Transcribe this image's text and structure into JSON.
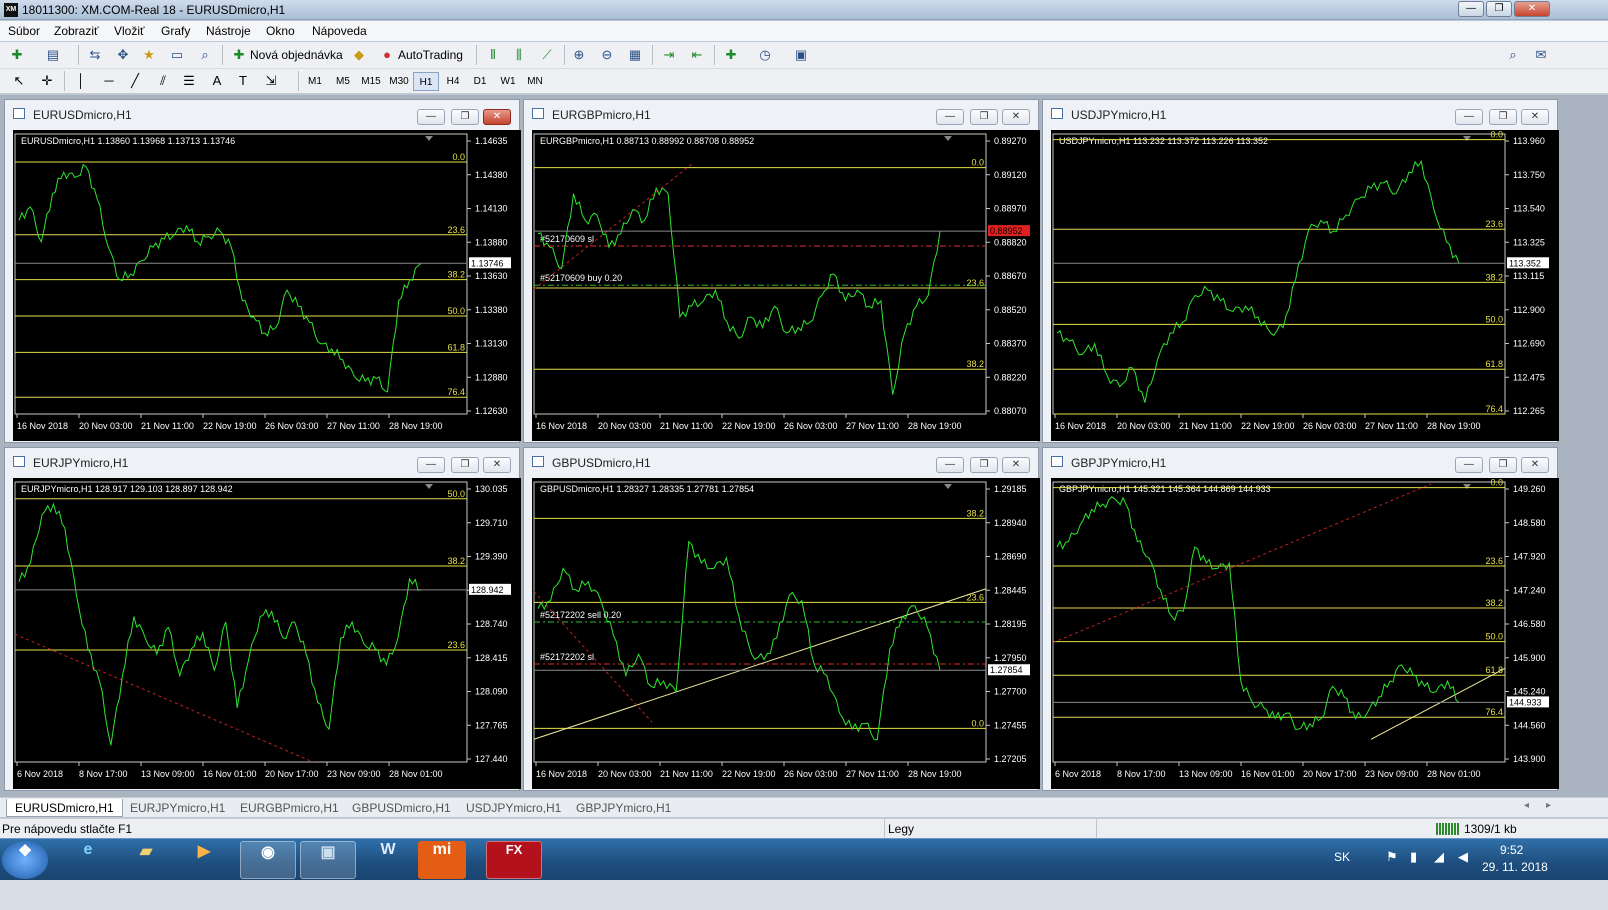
{
  "window": {
    "title": "18011300: XM.COM-Real 18 - EURUSDmicro,H1",
    "icon": "XM",
    "minimize": "—",
    "maximize": "❐",
    "close": "✕"
  },
  "menu": [
    "Súbor",
    "Zobraziť",
    "Vložiť",
    "Grafy",
    "Nástroje",
    "Okno",
    "Nápoveda"
  ],
  "toolbar": {
    "new_order": "Nová objednávka",
    "autotrading": "AutoTrading"
  },
  "timeframes": [
    "M1",
    "M5",
    "M15",
    "M30",
    "H1",
    "H4",
    "D1",
    "W1",
    "MN"
  ],
  "active_timeframe": "H1",
  "charts": [
    {
      "title": "EURUSDmicro,H1",
      "info": "EURUSDmicro,H1  1.13860 1.13968 1.13713 1.13746",
      "prices": [
        "1.14635",
        "1.14380",
        "1.14130",
        "1.13880",
        "1.13630",
        "1.13380",
        "1.13130",
        "1.12880",
        "1.12630"
      ],
      "current": "1.13746",
      "current_color": "#ffffff",
      "fib": [
        {
          "label": "0.0",
          "y": 0.1
        },
        {
          "label": "23.6",
          "y": 0.36
        },
        {
          "label": "38.2",
          "y": 0.52
        },
        {
          "label": "50.0",
          "y": 0.65
        },
        {
          "label": "61.8",
          "y": 0.78
        },
        {
          "label": "76.4",
          "y": 0.94
        }
      ],
      "dates": [
        "16 Nov 2018",
        "20 Nov 03:00",
        "21 Nov 11:00",
        "22 Nov 19:00",
        "26 Nov 03:00",
        "27 Nov 11:00",
        "28 Nov 19:00"
      ],
      "series": [
        0.3,
        0.25,
        0.38,
        0.2,
        0.12,
        0.14,
        0.1,
        0.22,
        0.4,
        0.52,
        0.5,
        0.45,
        0.4,
        0.37,
        0.35,
        0.32,
        0.38,
        0.36,
        0.34,
        0.4,
        0.6,
        0.66,
        0.72,
        0.7,
        0.56,
        0.62,
        0.68,
        0.76,
        0.78,
        0.82,
        0.88,
        0.9,
        0.89,
        0.94,
        0.6,
        0.52,
        0.46
      ],
      "active": true
    },
    {
      "title": "EURGBPmicro,H1",
      "info": "EURGBPmicro,H1  0.88713 0.88992 0.88708 0.88952",
      "prices": [
        "0.89270",
        "0.89120",
        "0.88970",
        "0.88820",
        "0.88670",
        "0.88520",
        "0.88370",
        "0.88220",
        "0.88070"
      ],
      "current": "0.88952",
      "current_color": "#ff3030",
      "fib": [
        {
          "label": "0.0",
          "y": 0.12
        },
        {
          "label": "23.6",
          "y": 0.55
        },
        {
          "label": "38.2",
          "y": 0.84
        }
      ],
      "orders": [
        {
          "label": "#52170609 sl",
          "y": 0.4
        },
        {
          "label": "#52170609 buy 0.20",
          "y": 0.54
        }
      ],
      "dates": [
        "16 Nov 2018",
        "20 Nov 03:00",
        "21 Nov 11:00",
        "22 Nov 19:00",
        "26 Nov 03:00",
        "27 Nov 11:00",
        "28 Nov 19:00"
      ],
      "series": [
        0.35,
        0.4,
        0.48,
        0.2,
        0.3,
        0.28,
        0.4,
        0.35,
        0.26,
        0.3,
        0.18,
        0.2,
        0.66,
        0.62,
        0.6,
        0.56,
        0.68,
        0.74,
        0.66,
        0.7,
        0.62,
        0.72,
        0.7,
        0.68,
        0.58,
        0.5,
        0.6,
        0.56,
        0.62,
        0.6,
        0.95,
        0.72,
        0.62,
        0.58,
        0.34
      ],
      "active": false
    },
    {
      "title": "USDJPYmicro,H1",
      "info": "USDJPYmicro,H1  113.232 113.372 113.226 113.352",
      "prices": [
        "113.960",
        "113.750",
        "113.540",
        "113.325",
        "113.115",
        "112.900",
        "112.690",
        "112.475",
        "112.265"
      ],
      "current": "113.352",
      "current_color": "#ffffff",
      "fib": [
        {
          "label": "0.0",
          "y": 0.02
        },
        {
          "label": "23.6",
          "y": 0.34
        },
        {
          "label": "38.2",
          "y": 0.53
        },
        {
          "label": "50.0",
          "y": 0.68
        },
        {
          "label": "61.8",
          "y": 0.84
        },
        {
          "label": "76.4",
          "y": 1.0
        }
      ],
      "dates": [
        "16 Nov 2018",
        "20 Nov 03:00",
        "21 Nov 11:00",
        "22 Nov 19:00",
        "26 Nov 03:00",
        "27 Nov 11:00",
        "28 Nov 19:00"
      ],
      "series": [
        0.72,
        0.75,
        0.8,
        0.76,
        0.88,
        0.92,
        0.85,
        0.98,
        0.82,
        0.72,
        0.68,
        0.58,
        0.56,
        0.6,
        0.64,
        0.62,
        0.66,
        0.72,
        0.7,
        0.52,
        0.34,
        0.3,
        0.34,
        0.28,
        0.22,
        0.18,
        0.16,
        0.2,
        0.12,
        0.08,
        0.26,
        0.38,
        0.46
      ],
      "active": false
    },
    {
      "title": "EURJPYmicro,H1",
      "info": "EURJPYmicro,H1  128.917 129.103 128.897 128.942",
      "prices": [
        "130.035",
        "129.710",
        "129.390",
        "129.065",
        "128.740",
        "128.415",
        "128.090",
        "127.765",
        "127.440"
      ],
      "current": "128.942",
      "current_color": "#ffffff",
      "fib": [
        {
          "label": "50.0",
          "y": 0.06
        },
        {
          "label": "38.2",
          "y": 0.3
        },
        {
          "label": "23.6",
          "y": 0.6
        }
      ],
      "dates": [
        "6 Nov 2018",
        "8 Nov 17:00",
        "13 Nov 09:00",
        "16 Nov 01:00",
        "20 Nov 17:00",
        "23 Nov 09:00",
        "28 Nov 01:00"
      ],
      "series": [
        0.35,
        0.28,
        0.1,
        0.06,
        0.15,
        0.4,
        0.6,
        0.72,
        0.96,
        0.7,
        0.48,
        0.56,
        0.62,
        0.52,
        0.7,
        0.6,
        0.54,
        0.68,
        0.5,
        0.82,
        0.64,
        0.48,
        0.46,
        0.56,
        0.5,
        0.62,
        0.8,
        0.9,
        0.56,
        0.5,
        0.58,
        0.6,
        0.66,
        0.56,
        0.34,
        0.38
      ],
      "active": false
    },
    {
      "title": "GBPUSDmicro,H1",
      "info": "GBPUSDmicro,H1  1.28327 1.28335 1.27781 1.27854",
      "prices": [
        "1.29185",
        "1.28940",
        "1.28690",
        "1.28445",
        "1.28195",
        "1.27950",
        "1.27700",
        "1.27455",
        "1.27205"
      ],
      "current": "1.27854",
      "current_color": "#ffffff",
      "fib": [
        {
          "label": "38.2",
          "y": 0.13
        },
        {
          "label": "23.6",
          "y": 0.43
        },
        {
          "label": "0.0",
          "y": 0.88
        }
      ],
      "orders": [
        {
          "label": "#52172202 sell 0.20",
          "y": 0.5
        },
        {
          "label": "#52172202 sl",
          "y": 0.65
        }
      ],
      "dates": [
        "16 Nov 2018",
        "20 Nov 03:00",
        "21 Nov 11:00",
        "22 Nov 19:00",
        "26 Nov 03:00",
        "27 Nov 11:00",
        "28 Nov 19:00"
      ],
      "series": [
        0.45,
        0.42,
        0.3,
        0.38,
        0.35,
        0.42,
        0.55,
        0.7,
        0.62,
        0.74,
        0.72,
        0.76,
        0.2,
        0.28,
        0.3,
        0.26,
        0.48,
        0.62,
        0.64,
        0.56,
        0.4,
        0.42,
        0.66,
        0.7,
        0.84,
        0.9,
        0.88,
        0.94,
        0.6,
        0.48,
        0.44,
        0.52,
        0.68
      ],
      "active": false
    },
    {
      "title": "GBPJPYmicro,H1",
      "info": "GBPJPYmicro,H1  145.321 145.364 144.869 144.933",
      "prices": [
        "149.260",
        "148.580",
        "147.920",
        "147.240",
        "146.580",
        "145.900",
        "145.240",
        "144.560",
        "143.900"
      ],
      "current": "144.933",
      "current_color": "#ffffff",
      "fib": [
        {
          "label": "0.0",
          "y": 0.02
        },
        {
          "label": "23.6",
          "y": 0.3
        },
        {
          "label": "38.2",
          "y": 0.45
        },
        {
          "label": "50.0",
          "y": 0.57
        },
        {
          "label": "61.8",
          "y": 0.69
        },
        {
          "label": "76.4",
          "y": 0.84
        }
      ],
      "dates": [
        "6 Nov 2018",
        "8 Nov 17:00",
        "13 Nov 09:00",
        "16 Nov 01:00",
        "20 Nov 17:00",
        "23 Nov 09:00",
        "28 Nov 01:00"
      ],
      "series": [
        0.22,
        0.2,
        0.14,
        0.08,
        0.06,
        0.04,
        0.06,
        0.2,
        0.26,
        0.38,
        0.48,
        0.46,
        0.22,
        0.28,
        0.3,
        0.28,
        0.72,
        0.8,
        0.82,
        0.86,
        0.84,
        0.9,
        0.88,
        0.86,
        0.74,
        0.78,
        0.86,
        0.84,
        0.78,
        0.72,
        0.66,
        0.7,
        0.74,
        0.76,
        0.72,
        0.8
      ],
      "active": false
    }
  ],
  "tabs": [
    "EURUSDmicro,H1",
    "EURJPYmicro,H1",
    "EURGBPmicro,H1",
    "GBPUSDmicro,H1",
    "USDJPYmicro,H1",
    "GBPJPYmicro,H1"
  ],
  "status": {
    "help": "Pre nápovedu stlačte F1",
    "profile": "Legy",
    "traffic": "1309/1 kb"
  },
  "taskbar": {
    "lang": "SK",
    "time": "9:52",
    "date": "29. 11. 2018",
    "apps": [
      "start-orb",
      "internet-explorer",
      "file-explorer",
      "media-player",
      "chrome",
      "remote-app",
      "word",
      "mi",
      "fxpro"
    ]
  }
}
